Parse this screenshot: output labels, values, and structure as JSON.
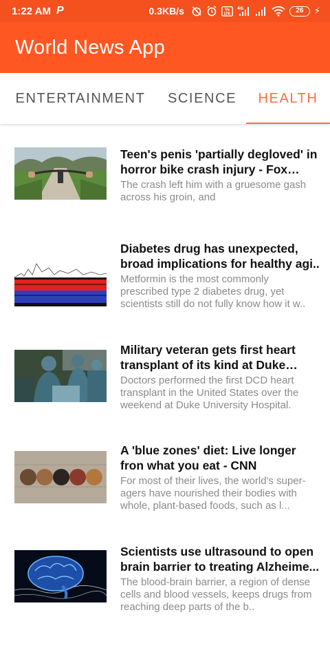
{
  "status_bar": {
    "time": "1:22 AM",
    "notification_icon": "p-icon",
    "speed": "0.3KB/s",
    "battery": "26",
    "icons": [
      "alarm-off-icon",
      "alarm-icon",
      "volte-icon",
      "signal-4g-icon",
      "signal-icon",
      "wifi-icon",
      "battery-icon",
      "charging-icon"
    ]
  },
  "app_bar": {
    "title": "World News App"
  },
  "tabs": [
    {
      "label": "ENTERTAINMENT",
      "active": false
    },
    {
      "label": "SCIENCE",
      "active": false
    },
    {
      "label": "HEALTH",
      "active": true
    }
  ],
  "colors": {
    "primary": "#ff5722",
    "status_bar": "#f4511e",
    "accent": "#ff6d3a",
    "desc_text": "#8a8a8a"
  },
  "articles": [
    {
      "title": "Teen's penis 'partially degloved' in horror bike crash injury - Fox News",
      "description": "The crash left him with a gruesome gash across his groin, and",
      "image": "bicycle-path-thumbnail"
    },
    {
      "title": "Diabetes drug has unexpected, broad implications for healthy agi..",
      "description": "Metformin is the most commonly prescribed type 2 diabetes drug, yet scientists still do not fully know how it w..",
      "image": "data-chart-thumbnail"
    },
    {
      "title": "Military veteran gets first heart transplant of its kind at Duke Hos...",
      "description": "Doctors performed the first DCD heart transplant in the United States over the weekend at Duke University Hospital.",
      "image": "surgery-thumbnail"
    },
    {
      "title": "A 'blue zones' diet: Live longer fron what you eat - CNN",
      "description": "For most of their lives, the world's super-agers have nourished their bodies with whole, plant-based foods, such as l...",
      "image": "legumes-thumbnail"
    },
    {
      "title": "Scientists use ultrasound to open brain barrier to treating Alzheime...",
      "description": "The blood-brain barrier, a region of dense cells and blood vessels, keeps drugs from reaching deep parts of the b..",
      "image": "brain-thumbnail"
    }
  ]
}
